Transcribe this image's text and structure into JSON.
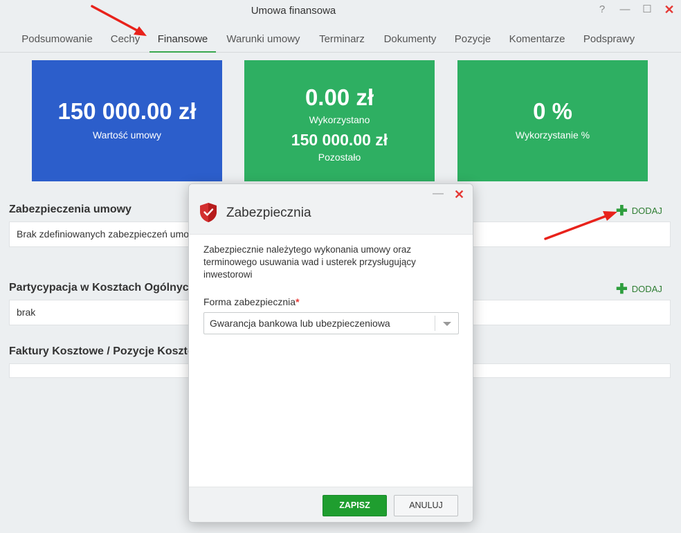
{
  "window": {
    "title": "Umowa finansowa",
    "help": "?",
    "minimize": "—",
    "maximize": "☐",
    "close": "✕"
  },
  "tabs": [
    {
      "label": "Podsumowanie"
    },
    {
      "label": "Cechy"
    },
    {
      "label": "Finansowe",
      "active": true
    },
    {
      "label": "Warunki umowy"
    },
    {
      "label": "Terminarz"
    },
    {
      "label": "Dokumenty"
    },
    {
      "label": "Pozycje"
    },
    {
      "label": "Komentarze"
    },
    {
      "label": "Podsprawy"
    }
  ],
  "stats": {
    "contract_value": {
      "value": "150 000.00 zł",
      "label": "Wartość umowy"
    },
    "used": {
      "value": "0.00 zł",
      "label": "Wykorzystano",
      "remaining_value": "150 000.00 zł",
      "remaining_label": "Pozostało"
    },
    "usage_percent": {
      "value": "0 %",
      "label": "Wykorzystanie %"
    }
  },
  "sections": {
    "securities": {
      "title": "Zabezpieczenia umowy",
      "value": "Brak zdefiniowanych zabezpieczeń umo",
      "add_label": "DODAJ"
    },
    "cost_participation": {
      "title": "Partycypacja w Kosztach Ogólnych",
      "value": "brak",
      "add_label": "DODAJ"
    },
    "invoices": {
      "title": "Faktury Kosztowe / Pozycje Kosztow",
      "value": ""
    }
  },
  "dialog": {
    "title": "Zabezpiecznia",
    "description": "Zabezpiecznie należytego wykonania umowy oraz terminowego usuwania wad i usterek przysługujący inwestorowi",
    "form_label": "Forma zabezpiecznia",
    "required_mark": "*",
    "selected_value": "Gwarancja bankowa lub ubezpieczeniowa",
    "save_label": "ZAPISZ",
    "cancel_label": "ANULUJ",
    "minimize": "—",
    "close": "✕"
  },
  "colors": {
    "accent_green": "#2eaf62",
    "stat_blue": "#2c5ecb",
    "save_button": "#1f9e2f",
    "close_red": "#e53935",
    "annotation_arrow": "#e8221b"
  },
  "icons": {
    "dialog": "shield-check-icon",
    "add": "plus-icon",
    "select": "chevron-down-icon"
  }
}
